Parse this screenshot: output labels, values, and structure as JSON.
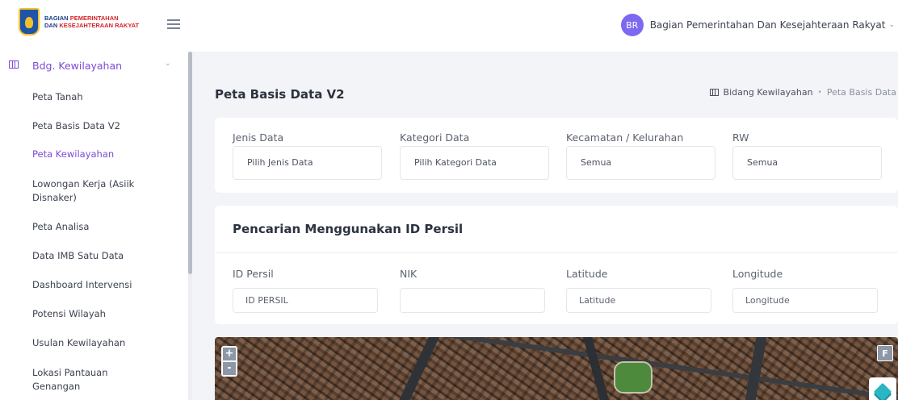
{
  "header": {
    "logo": {
      "line1_a": "BAGIAN",
      "line1_b": "PEMERINTAHAN",
      "line2_a": "DAN",
      "line2_b": "KESEJAHTERAAN RAKYAT"
    },
    "user": {
      "initials": "BR",
      "name": "Bagian Pemerintahan Dan Kesejahteraan Rakyat"
    }
  },
  "sidebar": {
    "group_label": "Bdg. Kewilayahan",
    "items": [
      {
        "label": "Peta Tanah"
      },
      {
        "label": "Peta Basis Data V2"
      },
      {
        "label": "Peta Kewilayahan"
      },
      {
        "label": "Lowongan Kerja (Asiik Disnaker)"
      },
      {
        "label": "Peta Analisa"
      },
      {
        "label": "Data IMB Satu Data"
      },
      {
        "label": "Dashboard Intervensi"
      },
      {
        "label": "Potensi Wilayah"
      },
      {
        "label": "Usulan Kewilayahan"
      },
      {
        "label": "Lokasi Pantauan Genangan"
      }
    ],
    "active_item": "Peta Kewilayahan"
  },
  "page": {
    "title": "Peta Basis Data V2",
    "breadcrumb": {
      "parent": "Bidang Kewilayahan",
      "separator": "•",
      "current": "Peta Basis Data"
    }
  },
  "filters": [
    {
      "label": "Jenis Data",
      "value": "Pilih Jenis Data"
    },
    {
      "label": "Kategori Data",
      "value": "Pilih Kategori Data"
    },
    {
      "label": "Kecamatan / Kelurahan",
      "value": "Semua"
    },
    {
      "label": "RW",
      "value": "Semua"
    }
  ],
  "search": {
    "title": "Pencarian Menggunakan ID Persil",
    "fields": [
      {
        "label": "ID Persil",
        "placeholder": "ID PERSIL",
        "value": ""
      },
      {
        "label": "NIK",
        "placeholder": "",
        "value": ""
      },
      {
        "label": "Latitude",
        "placeholder": "Latitude",
        "value": ""
      },
      {
        "label": "Longitude",
        "placeholder": "Longitude",
        "value": ""
      }
    ]
  },
  "map": {
    "zoom_in": "+",
    "zoom_out": "-",
    "fullscreen": "F",
    "icons": {
      "layers": "layers-icon"
    }
  },
  "colors": {
    "accent": "#7a4bd6",
    "avatar": "#7c69ef",
    "background": "#f2f4f7"
  }
}
